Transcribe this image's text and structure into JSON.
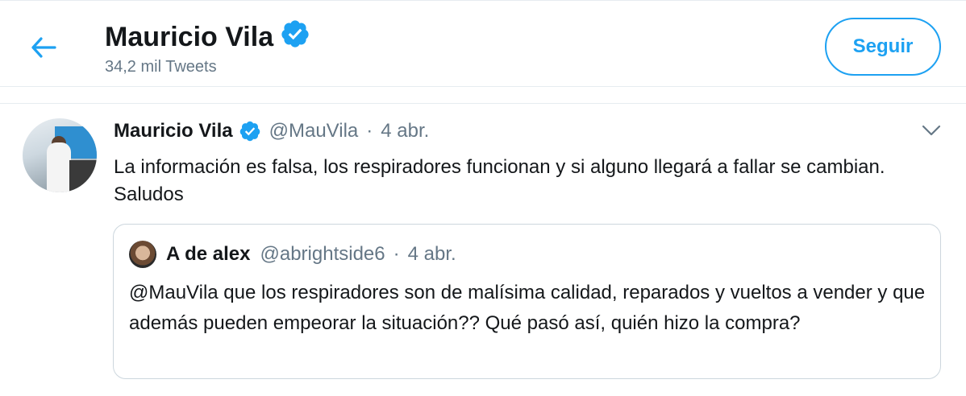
{
  "header": {
    "back_icon": "arrow-left-icon",
    "profile_name": "Mauricio Vila",
    "verified_icon": "verified-badge-icon",
    "tweet_count": "34,2 mil Tweets",
    "follow_label": "Seguir"
  },
  "tweet": {
    "author_name": "Mauricio Vila",
    "author_handle": "@MauVila",
    "separator": "·",
    "date": "4 abr.",
    "menu_icon": "chevron-down-icon",
    "text": "La información es falsa, los respiradores funcionan y si alguno llegará a fallar se cambian. Saludos",
    "quoted": {
      "author_name": "A de alex",
      "author_handle": "@abrightside6",
      "separator": "·",
      "date": "4 abr.",
      "text": "@MauVila que los respiradores son de malísima calidad, reparados y vueltos a vender y que además pueden empeorar la situación?? Qué pasó así, quién hizo la compra?"
    }
  },
  "colors": {
    "accent": "#1da1f2",
    "secondary_text": "#657786",
    "primary_text": "#14171a",
    "border": "#e6ecf0"
  }
}
